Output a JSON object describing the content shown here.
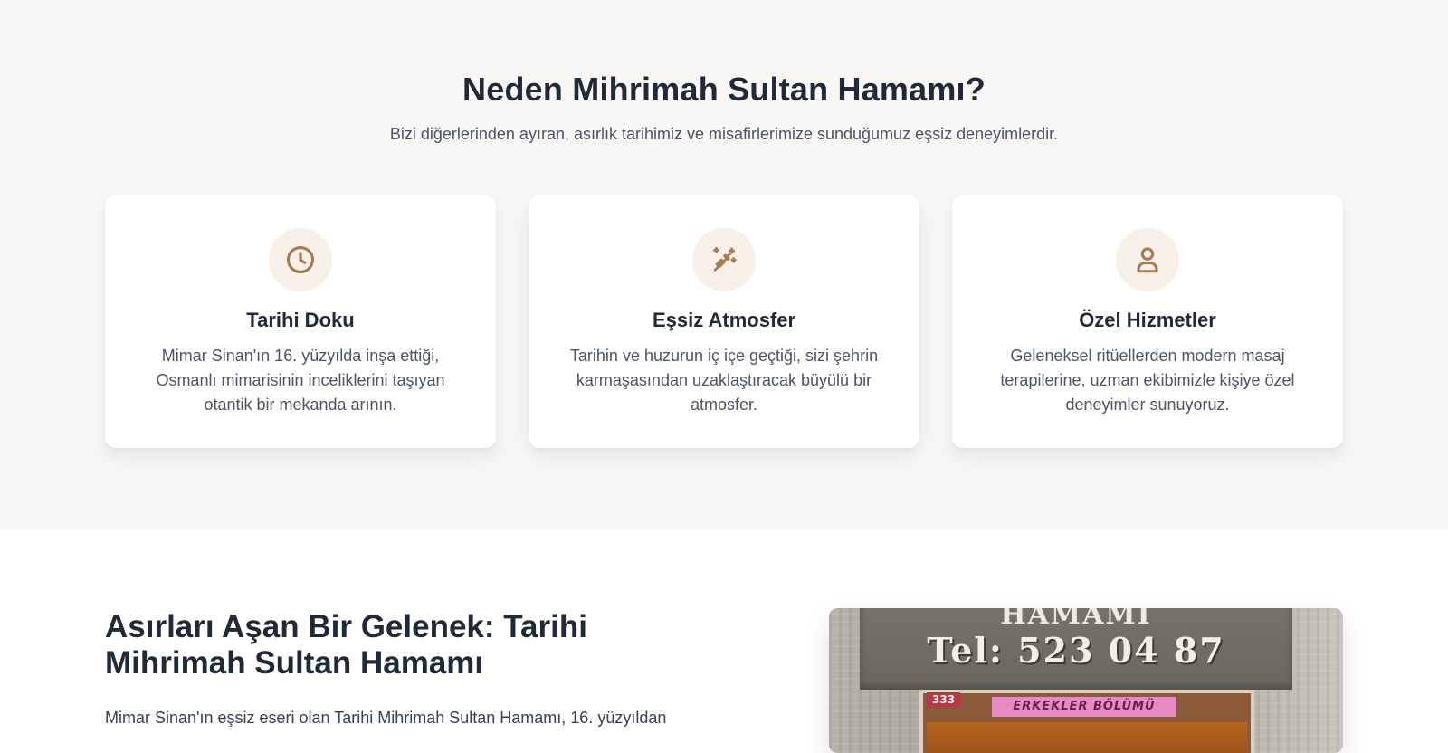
{
  "features": {
    "title": "Neden Mihrimah Sultan Hamamı?",
    "subtitle": "Bizi diğerlerinden ayıran, asırlık tarihimiz ve misafirlerimize sunduğumuz eşsiz deneyimlerdir.",
    "cards": [
      {
        "icon": "clock-icon",
        "title": "Tarihi Doku",
        "text": "Mimar Sinan'ın 16. yüzyılda inşa ettiği, Osmanlı mimarisinin inceliklerini taşıyan otantik bir mekanda arının."
      },
      {
        "icon": "magic-wand-icon",
        "title": "Eşsiz Atmosfer",
        "text": "Tarihin ve huzurun iç içe geçtiği, sizi şehrin karmaşasından uzaklaştıracak büyülü bir atmosfer."
      },
      {
        "icon": "user-icon",
        "title": "Özel Hizmetler",
        "text": "Geleneksel ritüellerden modern masaj terapilerine, uzman ekibimizle kişiye özel deneyimler sunuyoruz."
      }
    ]
  },
  "about": {
    "title": "Asırları Aşan Bir Gelenek: Tarihi Mihrimah Sultan Hamamı",
    "text": "Mimar Sinan'ın eşsiz eseri olan Tarihi Mihrimah Sultan Hamamı, 16. yüzyıldan",
    "photo": {
      "sign_top": "HAMAMI",
      "sign_tel": "Tel: 523 04 87",
      "number": "333",
      "banner": "ERKEKLER BÖLÜMÜ"
    }
  },
  "colors": {
    "accent": "#a67c52",
    "icon_bg": "#f6f0e9",
    "section_bg": "#f8f7f5",
    "heading": "#1f2937",
    "body_text": "#4b5563"
  }
}
